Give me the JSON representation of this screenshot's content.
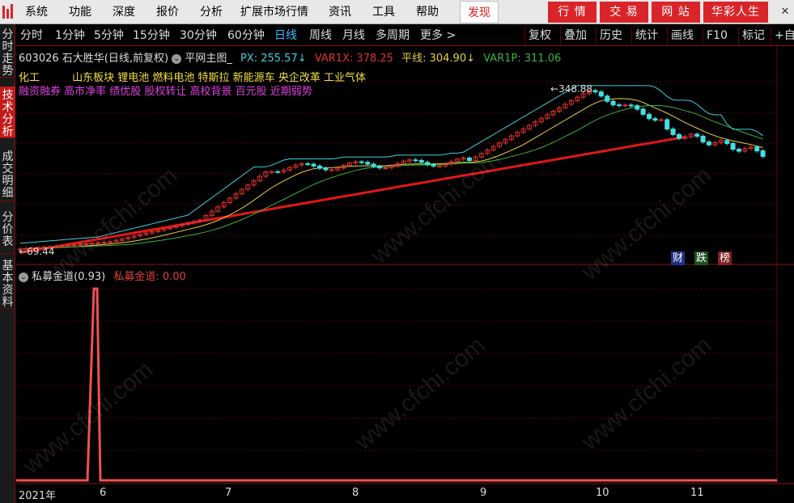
{
  "menubar": {
    "items": [
      "系统",
      "功能",
      "深度",
      "报价",
      "分析",
      "扩展市场行情",
      "资讯",
      "工具",
      "帮助"
    ],
    "active": "发现",
    "buttons": [
      "行 情",
      "交 易",
      "网 站",
      "华彩人生"
    ],
    "window_controls": [
      "—",
      "□",
      "✕"
    ]
  },
  "left_tabs": [
    {
      "label": "分时走势",
      "active": false
    },
    {
      "label": "技术分析",
      "active": true
    },
    {
      "label": "成交明细",
      "active": false
    },
    {
      "label": "分价表",
      "active": false
    },
    {
      "label": "基本资料",
      "active": false
    }
  ],
  "periods": [
    "分时",
    "1分钟",
    "5分钟",
    "15分钟",
    "30分钟",
    "60分钟",
    "日线",
    "周线",
    "月线",
    "多周期",
    "更多 >"
  ],
  "active_period": "日线",
  "toolbar_buttons": [
    "复权",
    "叠加",
    "历史",
    "统计",
    "画线",
    "F10",
    "标记",
    "+自"
  ],
  "info": {
    "stock": "603026 石大胜华(日线,前复权)",
    "indicator": "平网主图_",
    "px": "PX: 255.57",
    "var1x": "VAR1X: 378.25",
    "pingxian": "平线: 304.90",
    "var1p": "VAR1P: 311.06"
  },
  "concepts": {
    "row1_a": "化工",
    "row1_b": "山东板块  锂电池  燃料电池  特斯拉  新能源车  央企改革  工业气体",
    "row2": "融资融券  高市净率  绩优股  股权转让  高校背景  百元股  近期弱势"
  },
  "annotations": {
    "high": "348.88",
    "low": "69.44"
  },
  "badges": [
    "财",
    "跌",
    "榜"
  ],
  "sub_panel": {
    "name": "私募金道(0.93)",
    "value": "私募金道: 0.00"
  },
  "date_axis": [
    "2021年",
    "6",
    "7",
    "8",
    "9",
    "10",
    "11"
  ],
  "watermark": "www.cfchi.com",
  "colors": {
    "accent_red": "#d9252a",
    "price_line": "#e01818",
    "ma_yellow": "#e6d040",
    "ma_green": "#3ab040",
    "channel_cyan": "#40d0e0",
    "channel_red": "#c02020",
    "up_candle": "#e03030",
    "down_candle": "#40e0e0"
  },
  "chart_data": {
    "type": "line",
    "x_range": [
      "2021-05",
      "2021-11"
    ],
    "main_series": [
      {
        "name": "PX",
        "last": 255.57
      },
      {
        "name": "VAR1X",
        "last": 378.25
      },
      {
        "name": "平线",
        "last": 304.9
      },
      {
        "name": "VAR1P",
        "last": 311.06
      }
    ],
    "high": 348.88,
    "low": 69.44,
    "sub_indicator": {
      "name": "私募金道",
      "param": 0.93,
      "last": 0.0,
      "spike_month": "6"
    }
  }
}
